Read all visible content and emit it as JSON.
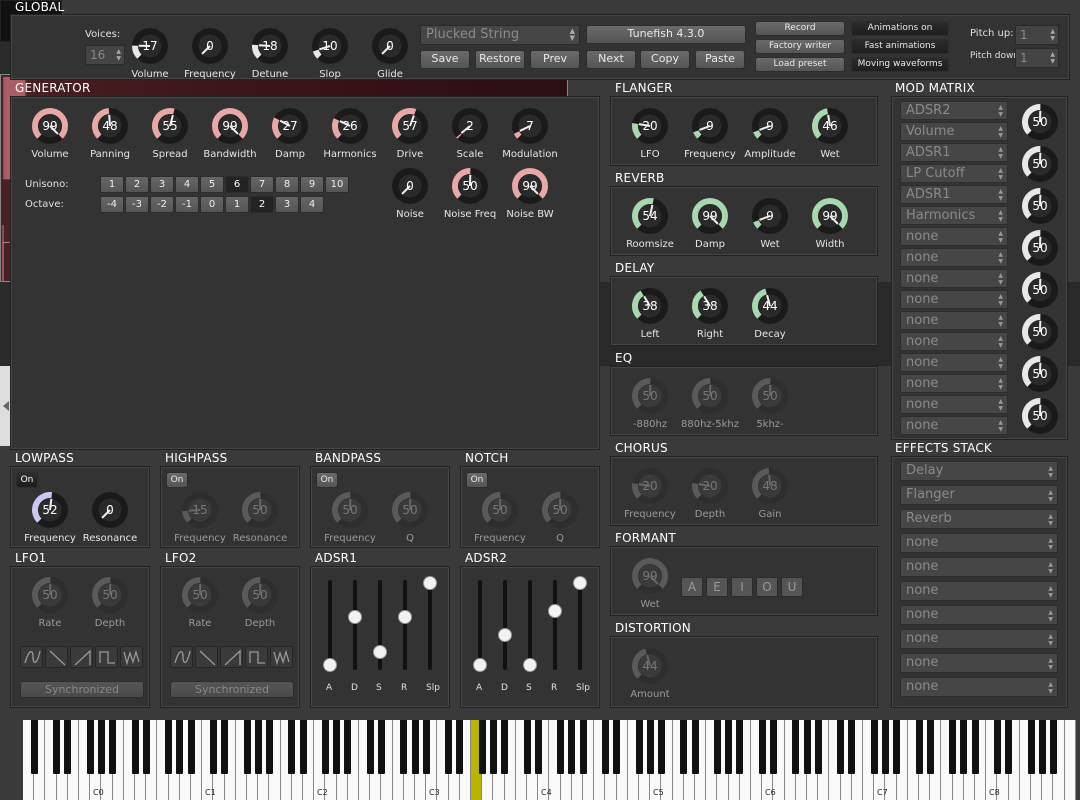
{
  "global": {
    "title": "GLOBAL",
    "voices_label": "Voices:",
    "voices_value": "16",
    "knobs": [
      {
        "label": "Volume",
        "value": "17"
      },
      {
        "label": "Frequency",
        "value": "0"
      },
      {
        "label": "Detune",
        "value": "18"
      },
      {
        "label": "Slop",
        "value": "10"
      },
      {
        "label": "Glide",
        "value": "0"
      }
    ],
    "preset_name": "Plucked String",
    "version": "Tunefish 4.3.0",
    "buttons": [
      "Save",
      "Restore",
      "Prev",
      "Next",
      "Copy",
      "Paste"
    ],
    "record": "Record",
    "factory_writer": "Factory writer",
    "load_preset": "Load preset",
    "animations_on": "Animations on",
    "fast_animations": "Fast animations",
    "moving_waveforms": "Moving waveforms",
    "pitch_up_label": "Pitch up:",
    "pitch_up_value": "1",
    "pitch_down_label": "Pitch down:",
    "pitch_down_value": "1"
  },
  "generator": {
    "title": "GENERATOR",
    "knobs": [
      {
        "label": "Volume",
        "value": "99"
      },
      {
        "label": "Panning",
        "value": "48"
      },
      {
        "label": "Spread",
        "value": "55"
      },
      {
        "label": "Bandwidth",
        "value": "99"
      },
      {
        "label": "Damp",
        "value": "27"
      },
      {
        "label": "Harmonics",
        "value": "26"
      },
      {
        "label": "Drive",
        "value": "57"
      },
      {
        "label": "Scale",
        "value": "2"
      },
      {
        "label": "Modulation",
        "value": "7"
      }
    ],
    "unisono_label": "Unisono:",
    "unisono": [
      "1",
      "2",
      "3",
      "4",
      "5",
      "6",
      "7",
      "8",
      "9",
      "10"
    ],
    "unisono_selected": "6",
    "octave_label": "Octave:",
    "octave": [
      "-4",
      "-3",
      "-2",
      "-1",
      "0",
      "1",
      "2",
      "3",
      "4"
    ],
    "octave_selected": "2",
    "noise_knobs": [
      {
        "label": "Noise",
        "value": "0"
      },
      {
        "label": "Noise Freq",
        "value": "50"
      },
      {
        "label": "Noise BW",
        "value": "99"
      }
    ]
  },
  "filters": {
    "lowpass": {
      "title": "LOWPASS",
      "toggle": "On",
      "knobs": [
        {
          "label": "Frequency",
          "value": "52"
        },
        {
          "label": "Resonance",
          "value": "0"
        }
      ]
    },
    "highpass": {
      "title": "HIGHPASS",
      "toggle": "On",
      "knobs": [
        {
          "label": "Frequency",
          "value": "15"
        },
        {
          "label": "Resonance",
          "value": "50"
        }
      ]
    },
    "bandpass": {
      "title": "BANDPASS",
      "toggle": "On",
      "knobs": [
        {
          "label": "Frequency",
          "value": "50"
        },
        {
          "label": "Q",
          "value": "50"
        }
      ]
    },
    "notch": {
      "title": "NOTCH",
      "toggle": "On",
      "knobs": [
        {
          "label": "Frequency",
          "value": "50"
        },
        {
          "label": "Q",
          "value": "50"
        }
      ]
    }
  },
  "lfo1": {
    "title": "LFO1",
    "knobs": [
      {
        "label": "Rate",
        "value": "50"
      },
      {
        "label": "Depth",
        "value": "50"
      }
    ],
    "sync": "Synchronized"
  },
  "lfo2": {
    "title": "LFO2",
    "knobs": [
      {
        "label": "Rate",
        "value": "50"
      },
      {
        "label": "Depth",
        "value": "50"
      }
    ],
    "sync": "Synchronized"
  },
  "adsr1": {
    "title": "ADSR1",
    "labels": [
      "A",
      "D",
      "S",
      "R",
      "Slp"
    ],
    "levels": [
      0.0,
      0.58,
      0.16,
      0.58,
      1.0
    ]
  },
  "adsr2": {
    "title": "ADSR2",
    "labels": [
      "A",
      "D",
      "S",
      "R",
      "Slp"
    ],
    "levels": [
      0.0,
      0.36,
      0.0,
      0.66,
      1.0
    ]
  },
  "flanger": {
    "title": "FLANGER",
    "knobs": [
      {
        "label": "LFO",
        "value": "20"
      },
      {
        "label": "Frequency",
        "value": "9"
      },
      {
        "label": "Amplitude",
        "value": "9"
      },
      {
        "label": "Wet",
        "value": "46"
      }
    ]
  },
  "reverb": {
    "title": "REVERB",
    "knobs": [
      {
        "label": "Roomsize",
        "value": "54"
      },
      {
        "label": "Damp",
        "value": "99"
      },
      {
        "label": "Wet",
        "value": "9"
      },
      {
        "label": "Width",
        "value": "99"
      }
    ]
  },
  "delay": {
    "title": "DELAY",
    "knobs": [
      {
        "label": "Left",
        "value": "38"
      },
      {
        "label": "Right",
        "value": "38"
      },
      {
        "label": "Decay",
        "value": "44"
      }
    ]
  },
  "eq": {
    "title": "EQ",
    "knobs": [
      {
        "label": "-880hz",
        "value": "50"
      },
      {
        "label": "880hz-5khz",
        "value": "50"
      },
      {
        "label": "5khz-",
        "value": "50"
      }
    ]
  },
  "chorus": {
    "title": "CHORUS",
    "knobs": [
      {
        "label": "Frequency",
        "value": "20"
      },
      {
        "label": "Depth",
        "value": "20"
      },
      {
        "label": "Gain",
        "value": "48"
      }
    ]
  },
  "formant": {
    "title": "FORMANT",
    "knob": {
      "label": "Wet",
      "value": "99"
    },
    "vowels": [
      "A",
      "E",
      "I",
      "O",
      "U"
    ]
  },
  "distortion": {
    "title": "DISTORTION",
    "knob": {
      "label": "Amount",
      "value": "44"
    }
  },
  "mod_matrix": {
    "title": "MOD MATRIX",
    "rows": [
      {
        "source": "ADSR2",
        "target": "Volume",
        "value": "50"
      },
      {
        "source": "ADSR1",
        "target": "LP Cutoff",
        "value": "50"
      },
      {
        "source": "ADSR1",
        "target": "Harmonics",
        "value": "50"
      },
      {
        "source": "none",
        "target": "none",
        "value": "50"
      },
      {
        "source": "none",
        "target": "none",
        "value": "50"
      },
      {
        "source": "none",
        "target": "none",
        "value": "50"
      },
      {
        "source": "none",
        "target": "none",
        "value": "50"
      },
      {
        "source": "none",
        "target": "none",
        "value": "50"
      }
    ]
  },
  "effects_stack": {
    "title": "EFFECTS STACK",
    "items": [
      "Delay",
      "Flanger",
      "Reverb",
      "none",
      "none",
      "none",
      "none",
      "none",
      "none",
      "none"
    ]
  },
  "keyboard": {
    "octaves": [
      "C0",
      "C1",
      "C2",
      "C3",
      "C4",
      "C5",
      "C6",
      "C7",
      "C8"
    ],
    "pressed_key": "C3"
  },
  "colors": {
    "generator": "#e8a8a8",
    "fx": "#a8d8b0",
    "lowpass": "#c8c8f0",
    "modmatrix": "#e8e8e8",
    "pressed": "#b8b400"
  }
}
